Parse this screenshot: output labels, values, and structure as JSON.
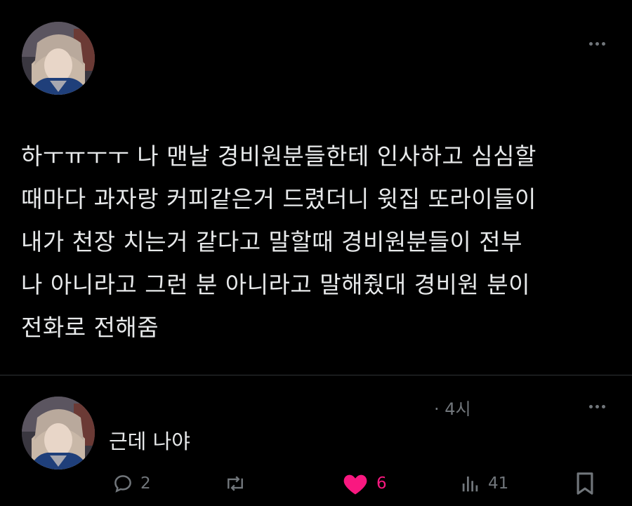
{
  "post": {
    "author_avatar": "avatar-image",
    "more_icon": "more-icon",
    "text_lines": [
      "하ㅜㅠㅜㅜ 나 맨날 경비원분들한테 인사하고 심심할",
      "때마다 과자랑 커피같은거 드렸더니 윗집 또라이들이",
      "내가 천장 치는거 같다고 말할때 경비원분들이 전부",
      "나 아니라고 그런 분 아니라고 말해줬대 경비원 분이",
      "전화로 전해줌"
    ]
  },
  "reply": {
    "author_avatar": "avatar-image",
    "timestamp": "· 4시",
    "more_icon": "more-icon",
    "text": "근데 나야",
    "actions": {
      "reply_count": "2",
      "repost_count": "",
      "like_count": "6",
      "view_count": "41"
    },
    "colors": {
      "like": "#f91880",
      "muted": "#71767b",
      "text": "#e7e9ea",
      "background": "#000000"
    }
  }
}
